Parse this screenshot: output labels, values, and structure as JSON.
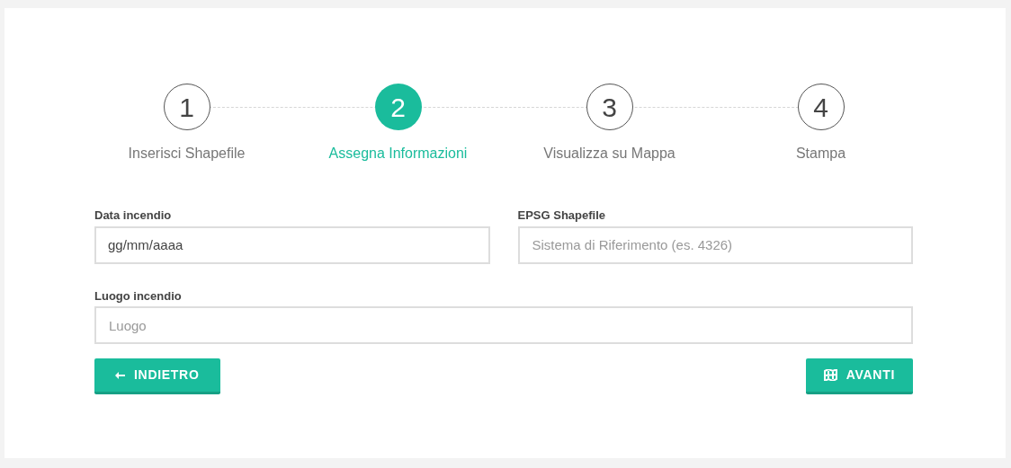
{
  "steps": [
    {
      "number": "1",
      "label": "Inserisci Shapefile",
      "selected": false
    },
    {
      "number": "2",
      "label": "Assegna Informazioni",
      "selected": true
    },
    {
      "number": "3",
      "label": "Visualizza su Mappa",
      "selected": false
    },
    {
      "number": "4",
      "label": "Stampa",
      "selected": false
    }
  ],
  "fields": [
    {
      "label": "Data incendio",
      "placeholder": "gg/mm/aaaa",
      "kind": "date"
    },
    {
      "label": "EPSG Shapefile",
      "placeholder": "Sistema di Riferimento (es. 4326)",
      "kind": "text"
    },
    {
      "label": "Luogo incendio",
      "placeholder": "Luogo",
      "kind": "wide"
    }
  ],
  "buttons": [
    {
      "label": "INDIETRO",
      "kind": "back"
    },
    {
      "label": "AVANTI",
      "kind": "next"
    }
  ]
}
